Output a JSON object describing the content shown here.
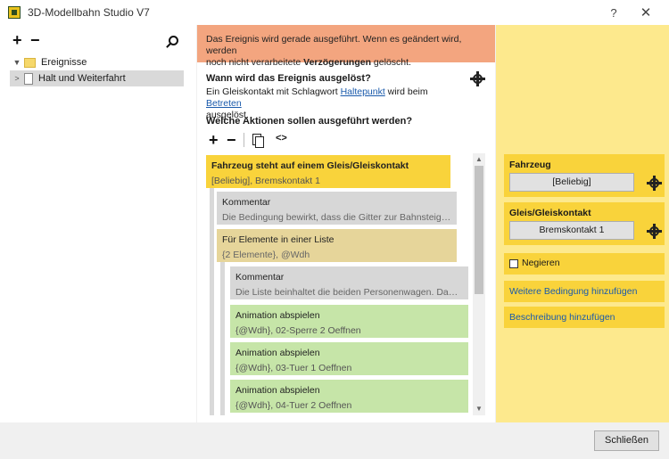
{
  "window": {
    "title": "3D-Modellbahn Studio V7",
    "help": "?",
    "close": "✕"
  },
  "tree": {
    "plus": "+",
    "minus": "−",
    "root": "Ereignisse",
    "child": "Halt und Weiterfahrt"
  },
  "warning": {
    "line1": "Das Ereignis wird gerade ausgeführt. Wenn es geändert wird, werden",
    "line2_pre": "noch nicht verarbeitete ",
    "line2_bold": "Verzögerungen",
    "line2_post": " gelöscht."
  },
  "trigger": {
    "question": "Wann wird das Ereignis ausgelöst?",
    "text1": "Ein Gleiskontakt mit Schlagwort ",
    "link1": "Haltepunkt",
    "text2": " wird beim ",
    "link2": "Betreten",
    "text3": "ausgelöst."
  },
  "actions": {
    "question": "Welche Aktionen sollen ausgeführt werden?",
    "plus": "+",
    "minus": "−",
    "code": "<>",
    "items": [
      {
        "title": "Fahrzeug steht auf einem Gleis/Gleiskontakt",
        "sub": "[Beliebig], Bremskontakt 1"
      },
      {
        "title": "Kommentar",
        "sub": "Die Bedingung bewirkt, dass die Gitter zur Bahnsteigseite …"
      },
      {
        "title": "Für Elemente in einer Liste",
        "sub": "{2 Elemente}, @Wdh"
      },
      {
        "title": "Kommentar",
        "sub": "Die Liste beinhaltet die beiden Personenwagen. Damit we…"
      },
      {
        "title": "Animation abspielen",
        "sub": "{@Wdh}, 02-Sperre 2 Oeffnen"
      },
      {
        "title": "Animation abspielen",
        "sub": "{@Wdh}, 03-Tuer 1 Oeffnen"
      },
      {
        "title": "Animation abspielen",
        "sub": "{@Wdh}, 04-Tuer 2 Oeffnen"
      }
    ]
  },
  "properties": {
    "vehicle_label": "Fahrzeug",
    "vehicle_value": "[Beliebig]",
    "track_label": "Gleis/Gleiskontakt",
    "track_value": "Bremskontakt 1",
    "negate_label": "Negieren",
    "add_condition": "Weitere Bedingung hinzufügen",
    "add_description": "Beschreibung hinzufügen"
  },
  "footer": {
    "close_label": "Schließen"
  },
  "colors": {
    "warning": "#f3a57f",
    "yellow": "#f9d33b",
    "panel": "#fde98d",
    "green": "#c6e5a8",
    "tan": "#e6d59a",
    "gray": "#d7d7d7",
    "link": "#1a5aab"
  }
}
